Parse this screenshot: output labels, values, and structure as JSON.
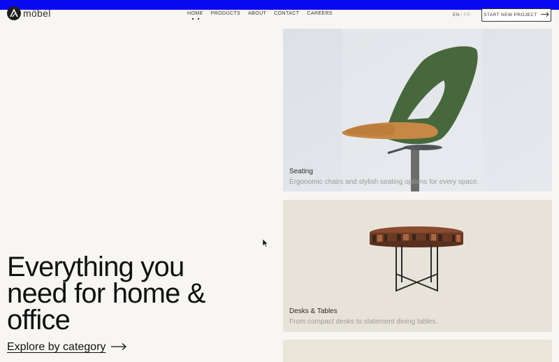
{
  "brand": {
    "name": "möbel"
  },
  "nav": {
    "items": [
      {
        "label": "HOME",
        "active": true
      },
      {
        "label": "PRODUCTS"
      },
      {
        "label": "ABOUT"
      },
      {
        "label": "CONTACT"
      },
      {
        "label": "CAREERS"
      }
    ]
  },
  "lang": {
    "current": "EN",
    "separator": "/",
    "other": "FR"
  },
  "cta": {
    "label": "START NEW PROJECT",
    "icon": "arrow-right-icon"
  },
  "hero": {
    "title_line1": "Everything you",
    "title_line2": "need for home &",
    "title_line3": "office",
    "explore_label": "Explore by category",
    "explore_icon": "arrow-right-icon"
  },
  "categories": [
    {
      "title": "Seating",
      "description": "Ergonomic chairs and stylish seating options for every space.",
      "image": "green-office-chair"
    },
    {
      "title": "Desks & Tables",
      "description": "From compact desks to statement dining tables.",
      "image": "round-wooden-table"
    }
  ],
  "colors": {
    "accent_bar": "#0a0af2",
    "background": "#f7f6f3",
    "seating_card": "#e1e4e8",
    "desks_card": "#e8e3d8"
  }
}
